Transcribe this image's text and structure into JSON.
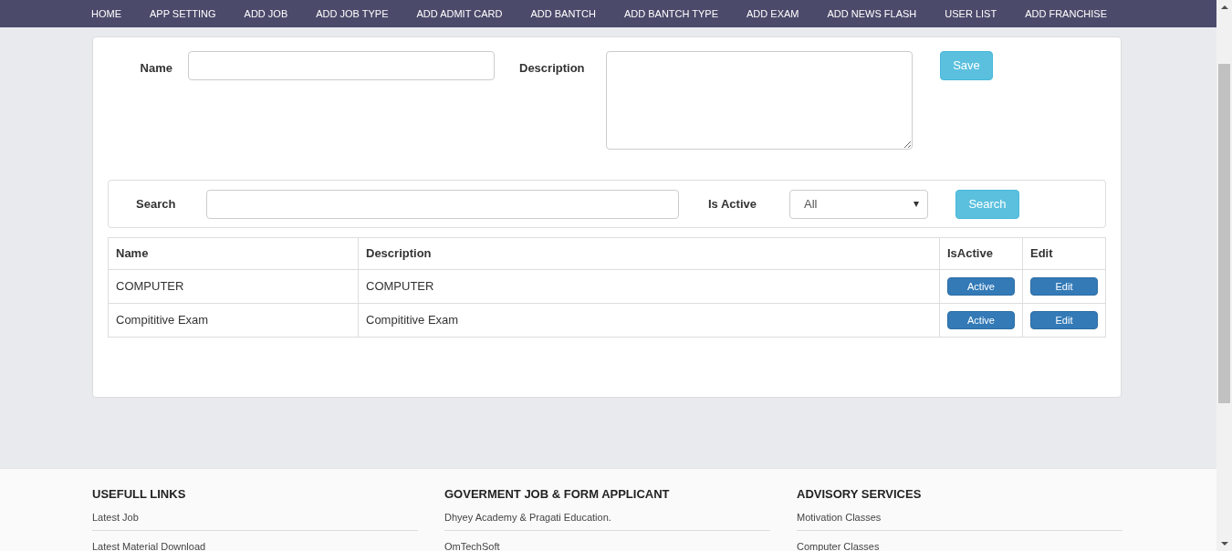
{
  "nav": [
    "HOME",
    "APP SETTING",
    "ADD JOB",
    "ADD JOB TYPE",
    "ADD ADMIT CARD",
    "ADD BANTCH",
    "ADD BANTCH TYPE",
    "ADD EXAM",
    "ADD NEWS FLASH",
    "USER LIST",
    "ADD FRANCHISE"
  ],
  "form": {
    "name_label": "Name",
    "description_label": "Description",
    "save": "Save"
  },
  "search": {
    "label": "Search",
    "active_label": "Is Active",
    "active_value": "All",
    "button": "Search"
  },
  "table": {
    "columns": [
      "Name",
      "Description",
      "IsActive",
      "Edit"
    ],
    "rows": [
      {
        "name": "COMPUTER",
        "description": "COMPUTER",
        "status": "Active",
        "edit": "Edit"
      },
      {
        "name": "Compititive Exam",
        "description": "Compititive Exam",
        "status": "Active",
        "edit": "Edit"
      }
    ]
  },
  "footer": [
    {
      "heading": "USEFULL LINKS",
      "links": [
        "Latest Job",
        "Latest Material Download"
      ]
    },
    {
      "heading": "GOVERMENT JOB & FORM APPLICANT",
      "links": [
        "Dhyey Academy & Pragati Education.",
        "OmTechSoft"
      ]
    },
    {
      "heading": "ADVISORY SERVICES",
      "links": [
        "Motivation Classes",
        "Computer Classes"
      ]
    }
  ]
}
